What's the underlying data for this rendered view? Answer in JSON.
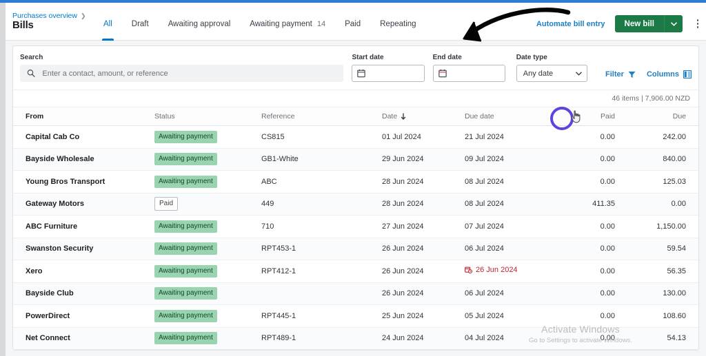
{
  "window": {
    "accent_blue": "#0078c8",
    "accent_green": "#1b7a45"
  },
  "header": {
    "breadcrumb": "Purchases overview",
    "breadcrumb_chevron": "chevron-right-icon",
    "title": "Bills",
    "tabs": [
      {
        "label": "All",
        "count": "",
        "active": true
      },
      {
        "label": "Draft",
        "count": "",
        "active": false
      },
      {
        "label": "Awaiting approval",
        "count": "",
        "active": false
      },
      {
        "label": "Awaiting payment",
        "count": "14",
        "active": false
      },
      {
        "label": "Paid",
        "count": "",
        "active": false
      },
      {
        "label": "Repeating",
        "count": "",
        "active": false
      }
    ],
    "automate_link": "Automate bill entry",
    "new_bill_label": "New bill",
    "new_bill_caret": "chevron-down-icon",
    "kebab": "more-options-icon"
  },
  "filters": {
    "search_label": "Search",
    "search_value": "",
    "search_placeholder": "Enter a contact, amount, or reference",
    "search_icon": "search-icon",
    "start_date_label": "Start date",
    "start_date_value": "",
    "end_date_label": "End date",
    "end_date_value": "",
    "calendar_icon": "calendar-icon",
    "date_type_label": "Date type",
    "date_type_value": "Any date",
    "date_type_options": [
      "Any date"
    ],
    "filter_label": "Filter",
    "filter_icon": "funnel-icon",
    "columns_label": "Columns",
    "columns_icon": "columns-icon"
  },
  "summary": {
    "text": "46 items | 7,906.00 NZD"
  },
  "table": {
    "columns": [
      {
        "label": "From",
        "sort": ""
      },
      {
        "label": "Status",
        "sort": ""
      },
      {
        "label": "Reference",
        "sort": ""
      },
      {
        "label": "Date",
        "sort": "arrow-down-icon"
      },
      {
        "label": "Due date",
        "sort": ""
      },
      {
        "label": "Paid",
        "sort": ""
      },
      {
        "label": "Due",
        "sort": ""
      }
    ],
    "rows": [
      {
        "from": "Capital Cab Co",
        "status": "Awaiting payment",
        "status_kind": "awaiting",
        "reference": "CS815",
        "date": "01 Jul 2024",
        "due_date": "21 Jul 2024",
        "overdue": false,
        "paid": "0.00",
        "due": "242.00"
      },
      {
        "from": "Bayside Wholesale",
        "status": "Awaiting payment",
        "status_kind": "awaiting",
        "reference": "GB1-White",
        "date": "29 Jun 2024",
        "due_date": "09 Jul 2024",
        "overdue": false,
        "paid": "0.00",
        "due": "840.00"
      },
      {
        "from": "Young Bros Transport",
        "status": "Awaiting payment",
        "status_kind": "awaiting",
        "reference": "ABC",
        "date": "28 Jun 2024",
        "due_date": "08 Jul 2024",
        "overdue": false,
        "paid": "0.00",
        "due": "125.03"
      },
      {
        "from": "Gateway Motors",
        "status": "Paid",
        "status_kind": "paid",
        "reference": "449",
        "date": "28 Jun 2024",
        "due_date": "08 Jul 2024",
        "overdue": false,
        "paid": "411.35",
        "due": "0.00"
      },
      {
        "from": "ABC Furniture",
        "status": "Awaiting payment",
        "status_kind": "awaiting",
        "reference": "710",
        "date": "27 Jun 2024",
        "due_date": "07 Jul 2024",
        "overdue": false,
        "paid": "0.00",
        "due": "1,150.00"
      },
      {
        "from": "Swanston Security",
        "status": "Awaiting payment",
        "status_kind": "awaiting",
        "reference": "RPT453-1",
        "date": "26 Jun 2024",
        "due_date": "06 Jul 2024",
        "overdue": false,
        "paid": "0.00",
        "due": "59.54"
      },
      {
        "from": "Xero",
        "status": "Awaiting payment",
        "status_kind": "awaiting",
        "reference": "RPT412-1",
        "date": "26 Jun 2024",
        "due_date": "26 Jun 2024",
        "overdue": true,
        "paid": "0.00",
        "due": "56.35"
      },
      {
        "from": "Bayside Club",
        "status": "Awaiting payment",
        "status_kind": "awaiting",
        "reference": "",
        "date": "26 Jun 2024",
        "due_date": "06 Jul 2024",
        "overdue": false,
        "paid": "0.00",
        "due": "130.00"
      },
      {
        "from": "PowerDirect",
        "status": "Awaiting payment",
        "status_kind": "awaiting",
        "reference": "RPT445-1",
        "date": "25 Jun 2024",
        "due_date": "05 Jul 2024",
        "overdue": false,
        "paid": "0.00",
        "due": "108.60"
      },
      {
        "from": "Net Connect",
        "status": "Awaiting payment",
        "status_kind": "awaiting",
        "reference": "RPT489-1",
        "date": "24 Jun 2024",
        "due_date": "04 Jul 2024",
        "overdue": false,
        "paid": "0.00",
        "due": "54.13"
      }
    ]
  },
  "annotations": {
    "arrow": "curved-arrow-annotation",
    "click_ring": "click-target-indicator",
    "cursor": "hand-cursor",
    "ring_color": "#5b44e0"
  },
  "watermark": {
    "line1": "Activate Windows",
    "line2": "Go to Settings to activate Windows."
  }
}
